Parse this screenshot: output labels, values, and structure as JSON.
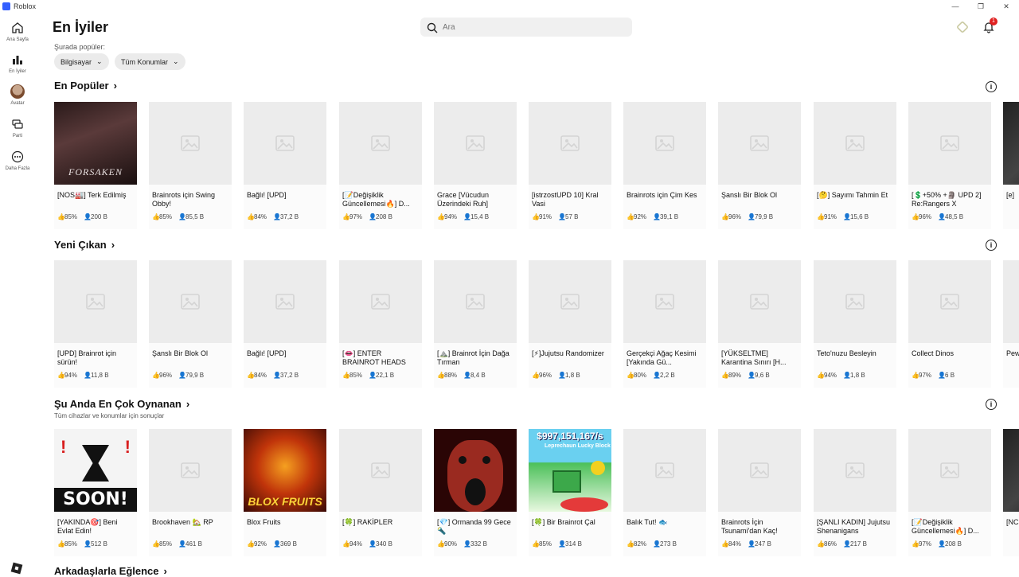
{
  "window": {
    "title": "Roblox",
    "controls": [
      "—",
      "❐",
      "✕"
    ]
  },
  "sidebar": {
    "items": [
      {
        "label": "Ana Sayfa",
        "icon": "home-icon"
      },
      {
        "label": "En İyiler",
        "icon": "charts-icon"
      },
      {
        "label": "Avatar",
        "icon": "avatar-icon"
      },
      {
        "label": "Parti",
        "icon": "party-icon"
      },
      {
        "label": "Daha Fazla",
        "icon": "more-icon"
      }
    ]
  },
  "header": {
    "title": "En İyiler",
    "search_placeholder": "Ara",
    "notification_count": "1"
  },
  "filters": {
    "label": "Şurada popüler:",
    "device": "Bilgisayar",
    "location": "Tüm Konumlar"
  },
  "sections": [
    {
      "title": "En Popüler",
      "subtitle": "",
      "games": [
        {
          "title": "[NOS🏭] Terk Edilmiş",
          "rating": "85%",
          "players": "200 B",
          "thumb": "forsaken",
          "thumb_text": "FORSAKEN"
        },
        {
          "title": "Brainrots için Swing Obby!",
          "rating": "85%",
          "players": "85,5 B"
        },
        {
          "title": "Bağlı! [UPD]",
          "rating": "84%",
          "players": "37,2 B"
        },
        {
          "title": "[📝Değişiklik Güncellemesi🔥] D...",
          "rating": "97%",
          "players": "208 B"
        },
        {
          "title": "Grace [Vücudun Üzerindeki Ruh]",
          "rating": "94%",
          "players": "15,4 B"
        },
        {
          "title": "[istrzostUPD 10] Kral Vasi",
          "rating": "91%",
          "players": "57 B"
        },
        {
          "title": "Brainrots için Çim Kes",
          "rating": "92%",
          "players": "39,1 B"
        },
        {
          "title": "Şanslı Bir Blok Ol",
          "rating": "96%",
          "players": "79,9 B"
        },
        {
          "title": "[🤔] Sayımı Tahmin Et",
          "rating": "91%",
          "players": "15,6 B"
        },
        {
          "title": "[💲+50% +🗿 UPD 2] Re:Rangers X",
          "rating": "96%",
          "players": "48,5 B"
        },
        {
          "title": "[e]",
          "rating": "",
          "players": "",
          "thumb": "edge"
        }
      ]
    },
    {
      "title": "Yeni Çıkan",
      "subtitle": "",
      "games": [
        {
          "title": "[UPD] Brainrot için sürün!",
          "rating": "94%",
          "players": "11,8 B"
        },
        {
          "title": "Şanslı Bir Blok Ol",
          "rating": "96%",
          "players": "79,9 B"
        },
        {
          "title": "Bağlı! [UPD]",
          "rating": "84%",
          "players": "37,2 B"
        },
        {
          "title": "[👄] ENTER BRAINROT HEADS",
          "rating": "85%",
          "players": "22,1 B"
        },
        {
          "title": "[⛰️] Brainrot İçin Dağa Tırman",
          "rating": "88%",
          "players": "8,4 B"
        },
        {
          "title": "[⚡]Jujutsu Randomizer",
          "rating": "96%",
          "players": "1,8 B"
        },
        {
          "title": "Gerçekçi Ağaç Kesimi [Yakında Gü...",
          "rating": "80%",
          "players": "2,2 B"
        },
        {
          "title": "[YÜKSELTME] Karantina Sınırı [H...",
          "rating": "89%",
          "players": "9,6 B"
        },
        {
          "title": "Teto'nuzu Besleyin",
          "rating": "94%",
          "players": "1,8 B"
        },
        {
          "title": "Collect Dinos",
          "rating": "97%",
          "players": "6 B"
        },
        {
          "title": "Pew",
          "rating": "",
          "players": ""
        }
      ]
    },
    {
      "title": "Şu Anda En Çok Oynanan",
      "subtitle": "Tüm cihazlar ve konumlar için sonuçlar",
      "games": [
        {
          "title": "[YAKINDA🎯] Beni Evlat Edin!",
          "rating": "85%",
          "players": "512 B",
          "thumb": "soon",
          "thumb_text": "SOON!"
        },
        {
          "title": "Brookhaven 🏡 RP",
          "rating": "85%",
          "players": "461 B"
        },
        {
          "title": "Blox Fruits",
          "rating": "92%",
          "players": "369 B",
          "thumb": "blox",
          "thumb_text": "BLOX FRUITS"
        },
        {
          "title": "[🍀] RAKİPLER",
          "rating": "94%",
          "players": "340 B"
        },
        {
          "title": "[💎] Ormanda 99 Gece 🔦",
          "rating": "90%",
          "players": "332 B",
          "thumb": "ormanda"
        },
        {
          "title": "[🍀] Bir Brainrot Çal",
          "rating": "85%",
          "players": "314 B",
          "thumb": "brainrot",
          "thumb_text": "$997,151,167/s",
          "thumb_sub": "Leprechaun Lucky Block"
        },
        {
          "title": "Balık Tut! 🐟",
          "rating": "82%",
          "players": "273 B"
        },
        {
          "title": "Brainrots İçin Tsunami'dan Kaç!",
          "rating": "84%",
          "players": "247 B"
        },
        {
          "title": "[ŞANLI KADIN] Jujutsu Shenanigans",
          "rating": "86%",
          "players": "217 B"
        },
        {
          "title": "[📝Değişiklik Güncellemesi🔥] D...",
          "rating": "97%",
          "players": "208 B"
        },
        {
          "title": "[NC",
          "rating": "",
          "players": "",
          "thumb": "edge"
        }
      ]
    },
    {
      "title": "Arkadaşlarla Eğlence",
      "subtitle": "",
      "games": []
    }
  ]
}
